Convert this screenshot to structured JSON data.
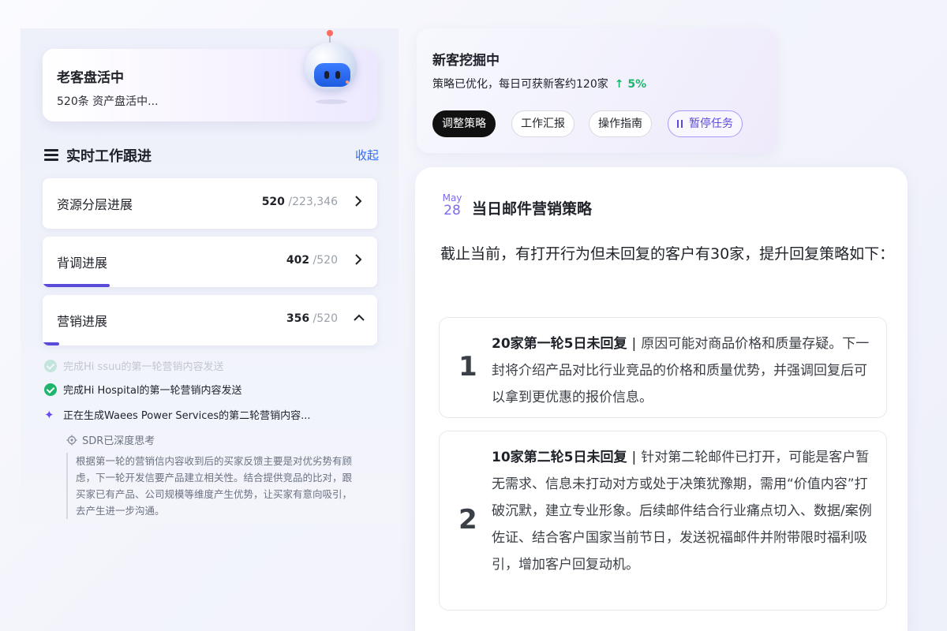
{
  "old_customer": {
    "title": "老客盘活中",
    "subtitle": "520条 资产盘活中..."
  },
  "realtime": {
    "title": "实时工作跟进",
    "collapse_label": "收起",
    "items": [
      {
        "label": "资源分层进展",
        "done": "520",
        "total": "/223,346",
        "expanded": false,
        "progress": 0
      },
      {
        "label": "背调进展",
        "done": "402",
        "total": "/520",
        "expanded": false,
        "progress": 0.2
      },
      {
        "label": "营销进展",
        "done": "356",
        "total": "/520",
        "expanded": true,
        "progress": 0.05
      }
    ],
    "tasks": [
      {
        "text": "完成Hi ssuu的第一轮营销内容发送",
        "status": "done-faded"
      },
      {
        "text": "完成Hi Hospital的第一轮营销内容发送",
        "status": "done"
      },
      {
        "text": "正在生成Waees Power Services的第二轮营销内容...",
        "status": "generating"
      }
    ],
    "thinking_label": "SDR已深度思考",
    "thinking_text": "根据第一轮的营销信内容收到后的买家反馈主要是对优劣势有顾虑，下一轮开发信要产品建立相关性。结合提供竞品的比对，跟买家已有产品、公司规模等维度产生优势，让买家有意向吸引，去产生进一步沟通。"
  },
  "new_customer": {
    "title": "新客挖掘中",
    "subtitle": "策略已优化，每日可获新客约120家",
    "growth": "↑ 5%",
    "actions": [
      "调整策略",
      "工作汇报",
      "操作指南",
      "暂停任务"
    ]
  },
  "strategy": {
    "month": "May",
    "day": "28",
    "title": "当日邮件营销策略",
    "intro": "截止当前，有打开行为但未回复的客户有30家，提升回复策略如下：",
    "items": [
      {
        "num": "1",
        "heading": "20家第一轮5日未回复",
        "separator": "|",
        "body": "原因可能对商品价格和质量存疑。下一封将介绍产品对比行业竞品的价格和质量优势，并强调回复后可以拿到更优惠的报价信息。"
      },
      {
        "num": "2",
        "heading": "10家第二轮5日未回复",
        "separator": "|",
        "body": "针对第二轮邮件已打开，可能是客户暂无需求、信息未打动对方或处于决策犹豫期，需用“价值内容”打破沉默，建立专业形象。后续邮件结合行业痛点切入、数据/案例佐证、结合客户国家当前节日，发送祝福邮件并附带限时福利吸引，增加客户回复动机。"
      }
    ]
  },
  "colors": {
    "accent": "#5b4bdb",
    "link": "#2f6bff",
    "success": "#1fb56e",
    "primary_button": "#111111"
  },
  "icons": [
    "robot-mascot-icon",
    "list-icon",
    "chevron-right-icon",
    "chevron-up-icon",
    "check-circle-icon",
    "sparkle-icon",
    "gear-icon",
    "pause-icon"
  ]
}
